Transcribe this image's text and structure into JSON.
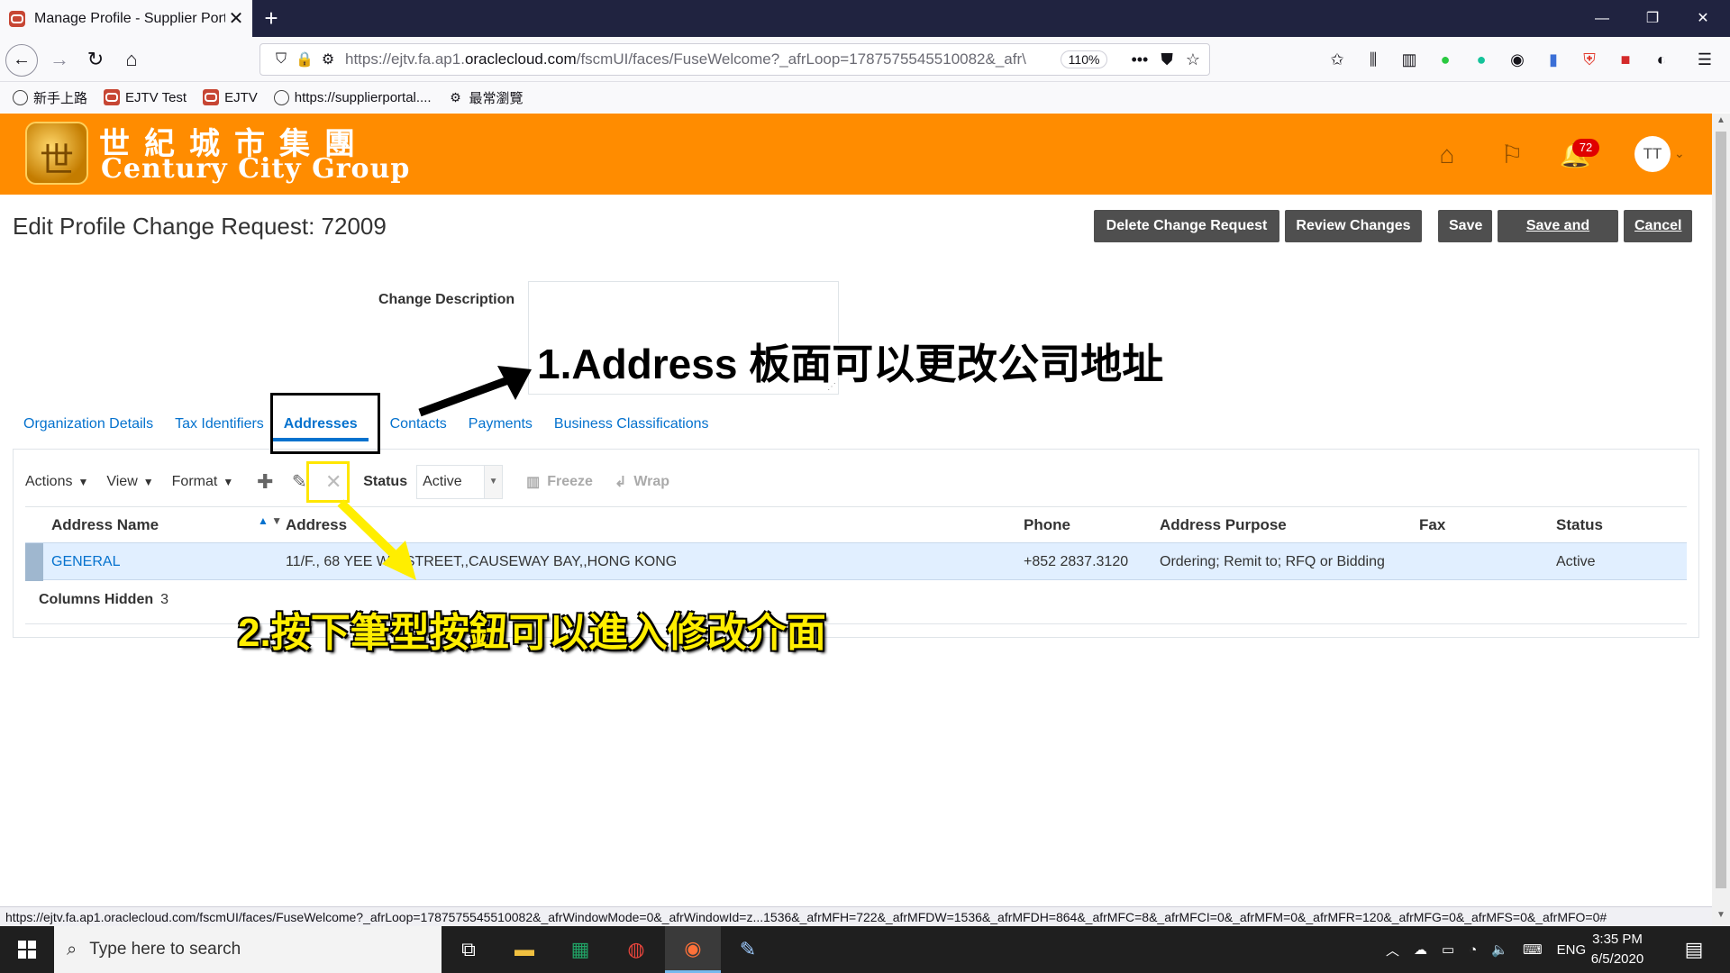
{
  "browser": {
    "tab_title": "Manage Profile - Supplier Porta",
    "url_prefix": "https://ejtv.fa.ap1.",
    "url_domain": "oraclecloud.com",
    "url_rest": "/fscmUI/faces/FuseWelcome?_afrLoop=1787575545510082&_afr\\",
    "zoom": "110%",
    "new_tab": "+",
    "bookmarks": [
      {
        "label": "新手上路",
        "icon": "globe-icon"
      },
      {
        "label": "EJTV Test",
        "icon": "oracle-icon"
      },
      {
        "label": "EJTV",
        "icon": "oracle-icon"
      },
      {
        "label": "https://supplierportal....",
        "icon": "globe-icon"
      },
      {
        "label": "最常瀏覽",
        "icon": "gear-icon"
      }
    ],
    "status_url": "https://ejtv.fa.ap1.oraclecloud.com/fscmUI/faces/FuseWelcome?_afrLoop=1787575545510082&_afrWindowMode=0&_afrWindowId=z...1536&_afrMFH=722&_afrMFDW=1536&_afrMFDH=864&_afrMFC=8&_afrMFCI=0&_afrMFM=0&_afrMFR=120&_afrMFG=0&_afrMFS=0&_afrMFO=0#"
  },
  "brand": {
    "name_cn": "世紀城市集團",
    "name_en": "Century City Group",
    "color": "#ff8c00",
    "notification_count": "72",
    "avatar_initials": "TT"
  },
  "page": {
    "title": "Edit Profile Change Request: 72009",
    "buttons": {
      "delete": "Delete Change Request",
      "review": "Review Changes",
      "save": "Save",
      "save_close": "Save and Close",
      "cancel": "Cancel"
    },
    "change_description_label": "Change Description",
    "tabs": [
      {
        "label": "Organization Details"
      },
      {
        "label": "Tax Identifiers"
      },
      {
        "label": "Addresses",
        "active": true
      },
      {
        "label": "Contacts"
      },
      {
        "label": "Payments"
      },
      {
        "label": "Business Classifications"
      }
    ]
  },
  "toolbar": {
    "actions": "Actions",
    "view": "View",
    "format": "Format",
    "status_label": "Status",
    "status_value": "Active",
    "freeze": "Freeze",
    "wrap": "Wrap"
  },
  "grid": {
    "columns": {
      "name": "Address Name",
      "address": "Address",
      "phone": "Phone",
      "purpose": "Address Purpose",
      "fax": "Fax",
      "status": "Status"
    },
    "rows": [
      {
        "name": "GENERAL",
        "address": "11/F., 68 YEE WO STREET,,CAUSEWAY BAY,,HONG KONG",
        "phone": "+852 2837.3120",
        "purpose": "Ordering; Remit to; RFQ or Bidding",
        "fax": "",
        "status": "Active"
      }
    ],
    "columns_hidden_label": "Columns Hidden",
    "columns_hidden_count": "3"
  },
  "annotations": {
    "step1": "1.Address 板面可以更改公司地址",
    "step2": "2.按下筆型按鈕可以進入修改介面"
  },
  "taskbar": {
    "search_placeholder": "Type here to search",
    "lang": "ENG",
    "time": "3:35 PM",
    "date": "6/5/2020"
  }
}
